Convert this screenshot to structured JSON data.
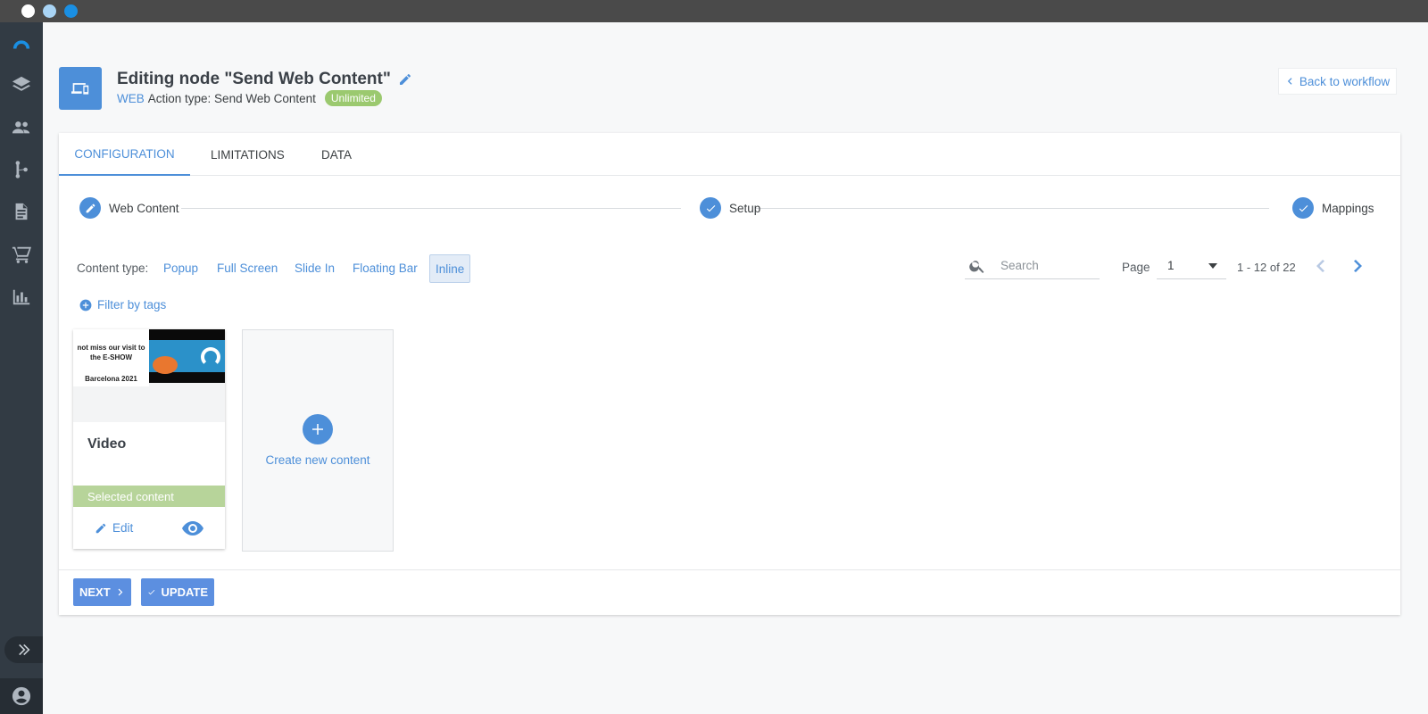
{
  "window": {
    "controls": [
      "close",
      "minimize",
      "maximize"
    ]
  },
  "rail": {
    "icons": [
      "logo-icon",
      "layers-icon",
      "users-icon",
      "workflow-icon",
      "document-icon",
      "cart-icon",
      "chart-icon"
    ],
    "expand_icon": "double-chevron-right-icon",
    "user_icon": "user-circle-icon"
  },
  "header": {
    "title": "Editing node \"Send Web Content\"",
    "channel": "WEB",
    "action_type": "Action type: Send Web Content",
    "badge": "Unlimited",
    "back_label": "Back to workflow"
  },
  "tabs": [
    {
      "label": "CONFIGURATION",
      "active": true
    },
    {
      "label": "LIMITATIONS",
      "active": false
    },
    {
      "label": "DATA",
      "active": false
    }
  ],
  "steps": [
    {
      "label": "Web Content",
      "state": "editing"
    },
    {
      "label": "Setup",
      "state": "done"
    },
    {
      "label": "Mappings",
      "state": "done"
    }
  ],
  "content_type": {
    "label": "Content type:",
    "options": [
      "Popup",
      "Full Screen",
      "Slide In",
      "Floating Bar",
      "Inline"
    ],
    "selected": "Inline"
  },
  "search": {
    "placeholder": "Search",
    "value": ""
  },
  "pagination": {
    "page_label": "Page",
    "page_value": "1",
    "range": "1 - 12 of 22"
  },
  "filter_label": "Filter by tags",
  "content_items": [
    {
      "thumb_lines": [
        "not miss our visit to",
        "the E-SHOW",
        "Barcelona 2021"
      ],
      "title": "Video",
      "status": "Selected content",
      "edit_label": "Edit"
    }
  ],
  "create_label": "Create new content",
  "footer": {
    "next_label": "NEXT",
    "update_label": "UPDATE"
  },
  "colors": {
    "accent": "#4d8fd9",
    "rail": "#323b44",
    "selected": "#b7d49a",
    "badge": "#9bc96f"
  }
}
